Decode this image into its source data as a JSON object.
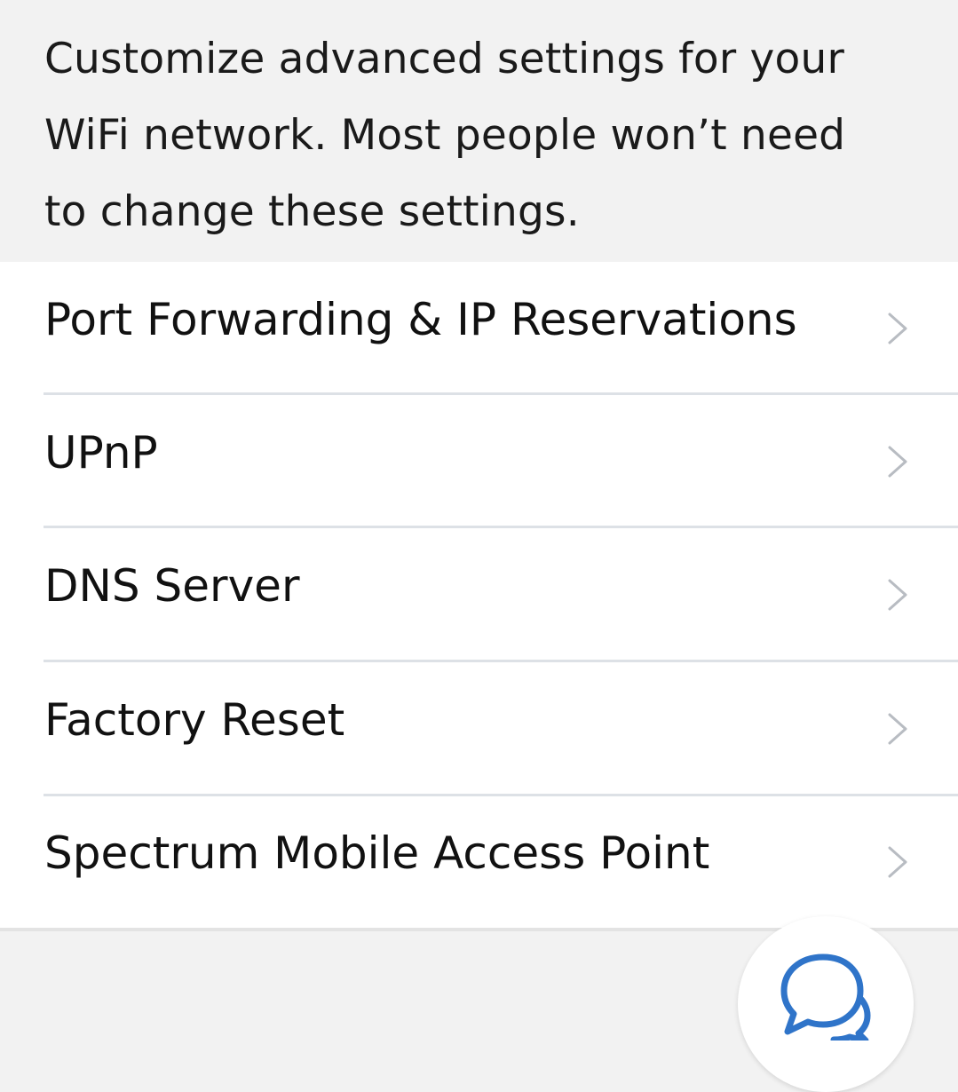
{
  "header": {
    "description": "Customize advanced settings for your WiFi network. Most people won’t need to change these settings.",
    "description_lines": [
      "Customize advanced settings for your",
      "WiFi network. Most people won’t need",
      "to change these settings."
    ]
  },
  "settings": {
    "items": [
      {
        "label": "Port Forwarding & IP Reservations",
        "icon": "chevron-right-icon"
      },
      {
        "label": "UPnP",
        "icon": "chevron-right-icon"
      },
      {
        "label": "DNS Server",
        "icon": "chevron-right-icon"
      },
      {
        "label": "Factory Reset",
        "icon": "chevron-right-icon"
      },
      {
        "label": "Spectrum Mobile Access Point",
        "icon": "chevron-right-icon"
      }
    ]
  },
  "chat": {
    "icon": "chat-bubbles-icon"
  },
  "colors": {
    "background": "#f2f2f2",
    "list_background": "#ffffff",
    "text": "#1a1a1a",
    "divider": "#dde1e6",
    "chevron": "#b8bcc2",
    "chat_accent": "#2f74c9"
  }
}
